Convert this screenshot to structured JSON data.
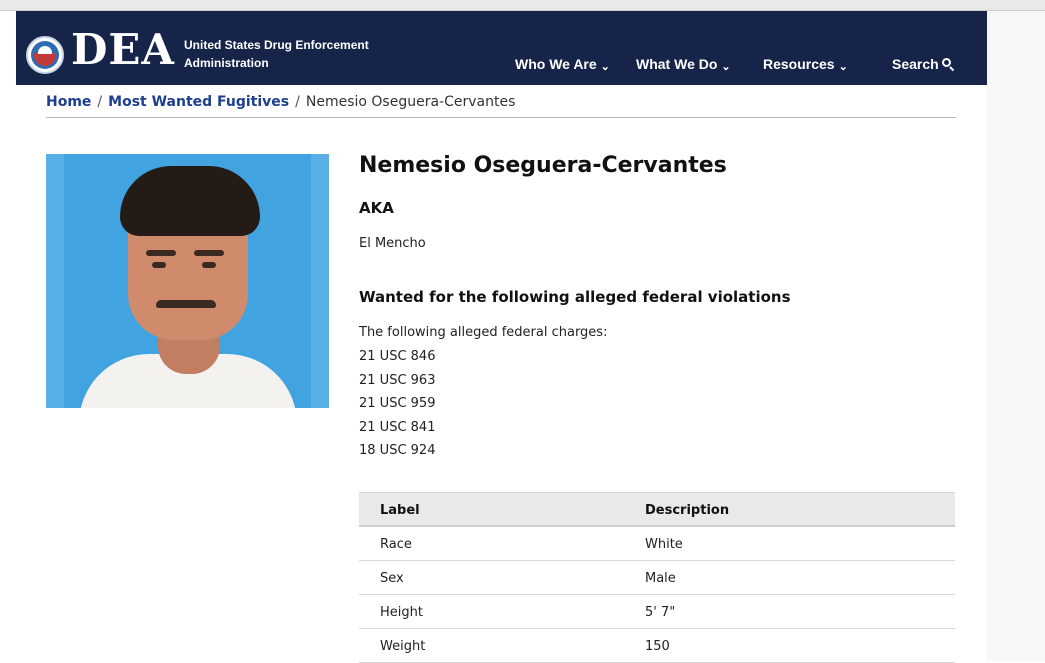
{
  "header": {
    "logo_text": "DEA",
    "agency_line1": "United States Drug Enforcement",
    "agency_line2": "Administration",
    "nav": [
      {
        "label": "Who We Are"
      },
      {
        "label": "What We Do"
      },
      {
        "label": "Resources"
      }
    ],
    "search_label": "Search"
  },
  "breadcrumb": {
    "home": "Home",
    "section": "Most Wanted Fugitives",
    "current": "Nemesio Oseguera-Cervantes",
    "separator": "/"
  },
  "profile": {
    "name": "Nemesio Oseguera-Cervantes",
    "aka_label": "AKA",
    "aka_value": "El Mencho",
    "violations_title": "Wanted for the following alleged federal violations",
    "charges_intro": "The following alleged federal charges:",
    "charges": [
      "21 USC 846",
      "21 USC 963",
      "21 USC 959",
      "21 USC 841",
      "18 USC 924"
    ]
  },
  "details_table": {
    "headers": [
      "Label",
      "Description"
    ],
    "rows": [
      [
        "Race",
        "White"
      ],
      [
        "Sex",
        "Male"
      ],
      [
        "Height",
        "5' 7\""
      ],
      [
        "Weight",
        "150"
      ]
    ]
  },
  "colors": {
    "header_bg": "#17244a",
    "link": "#1d3f8f",
    "photo_bg": "#41a3df"
  }
}
